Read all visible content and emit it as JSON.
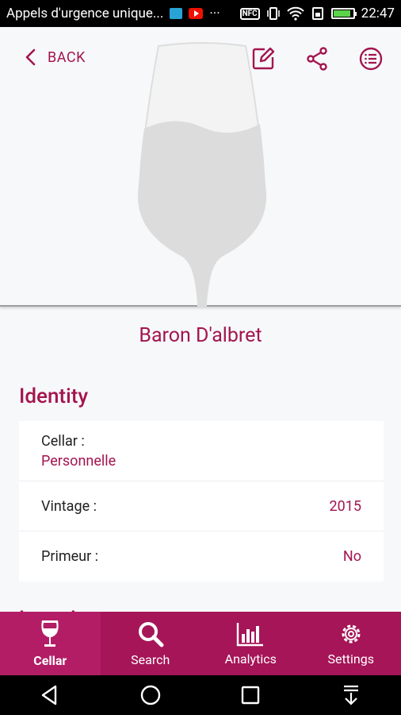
{
  "status_bar": {
    "notification_text": "Appels d'urgence unique...",
    "dots": "···",
    "time": "22:47",
    "nfc_label": "NFC",
    "icons": [
      "gallery-icon",
      "youtube-icon",
      "nfc-icon",
      "vibrate-icon",
      "wifi-icon",
      "sim-icon",
      "battery-icon"
    ],
    "battery_level": 0.9
  },
  "header": {
    "back_label": "BACK",
    "icons": [
      "edit-icon",
      "share-icon",
      "list-icon"
    ]
  },
  "wine": {
    "name": "Baron D'albret"
  },
  "identity": {
    "title": "Identity",
    "cellar_label": "Cellar :",
    "cellar_value": "Personnelle",
    "vintage_label": "Vintage :",
    "vintage_value": "2015",
    "primeur_label": "Primeur :",
    "primeur_value": "No"
  },
  "next_section_peek": "Location",
  "bottom_nav": {
    "items": [
      {
        "label": "Cellar",
        "icon": "wine-glass-icon",
        "active": true
      },
      {
        "label": "Search",
        "icon": "search-icon",
        "active": false
      },
      {
        "label": "Analytics",
        "icon": "bar-chart-icon",
        "active": false
      },
      {
        "label": "Settings",
        "icon": "gear-icon",
        "active": false
      }
    ]
  },
  "colors": {
    "accent": "#a3154f",
    "nav_bg": "#a51558",
    "nav_active": "#b31d65",
    "glass": "#dcdcdc"
  }
}
